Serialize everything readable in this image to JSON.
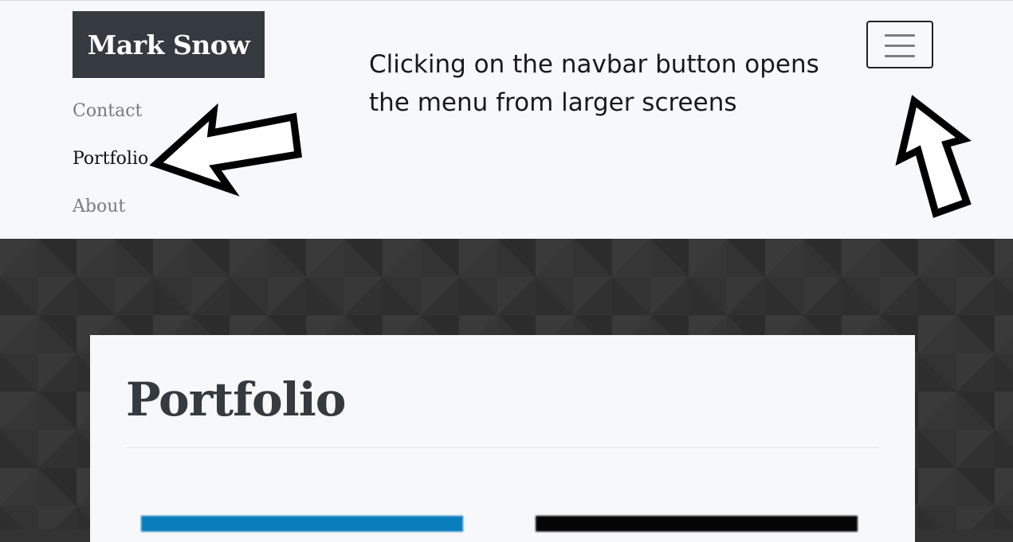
{
  "navbar": {
    "brand": "Mark Snow",
    "links": [
      {
        "label": "Contact",
        "active": false
      },
      {
        "label": "Portfolio",
        "active": true
      },
      {
        "label": "About",
        "active": false
      }
    ],
    "toggler_icon": "hamburger-icon"
  },
  "annotation": {
    "text": "Clicking on the navbar button opens the menu from larger screens"
  },
  "main": {
    "title": "Portfolio",
    "thumbnails": [
      {
        "name": "portfolio-thumbnail-1",
        "color": "#0a7dbd"
      },
      {
        "name": "portfolio-thumbnail-2",
        "color": "#050505"
      }
    ]
  },
  "colors": {
    "navbar_bg": "#f7f8fa",
    "brand_bg": "#343a40",
    "hero_bg": "#333333",
    "card_bg": "#f7f8fa"
  }
}
